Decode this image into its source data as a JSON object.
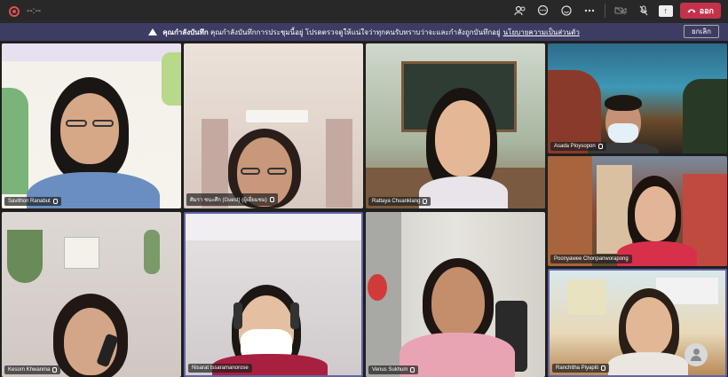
{
  "topbar": {
    "timer": "--:--",
    "leave_label": "ออก",
    "share_label": "↑",
    "icons": [
      "participants-icon",
      "chat-icon",
      "reactions-icon",
      "more-icon",
      "camera-off-icon",
      "mic-off-icon",
      "share-icon"
    ]
  },
  "banner": {
    "title": "คุณกำลังบันทึก",
    "message": "คุณกำลังบันทึกการประชุมนี้อยู่ โปรดตรวจดูให้แน่ใจว่าทุกคนรับทราบว่าจะและกำลังถูกบันทึกอยู่",
    "link": "นโยบายความเป็นส่วนตัว",
    "dismiss_label": "ยกเลิก"
  },
  "participants": [
    {
      "name": "Savithon Ranabut"
    },
    {
      "name": "ศิมรา ชนะศึก (Guest) (ผู้เยี่ยมชม)"
    },
    {
      "name": "Rattaya Chuanklang"
    },
    {
      "name": "Asada Ploysopon"
    },
    {
      "name": "Poonyawee Chonpanworapong"
    },
    {
      "name": "Kesorn Khwanma"
    },
    {
      "name": "Nisarat Issaramanorose"
    },
    {
      "name": "Venus Sukhum"
    },
    {
      "name": "Ranchitha Piyapiti"
    }
  ],
  "colors": {
    "accent": "#3d3c63",
    "leave": "#c4314b",
    "background": "#201f1f"
  }
}
